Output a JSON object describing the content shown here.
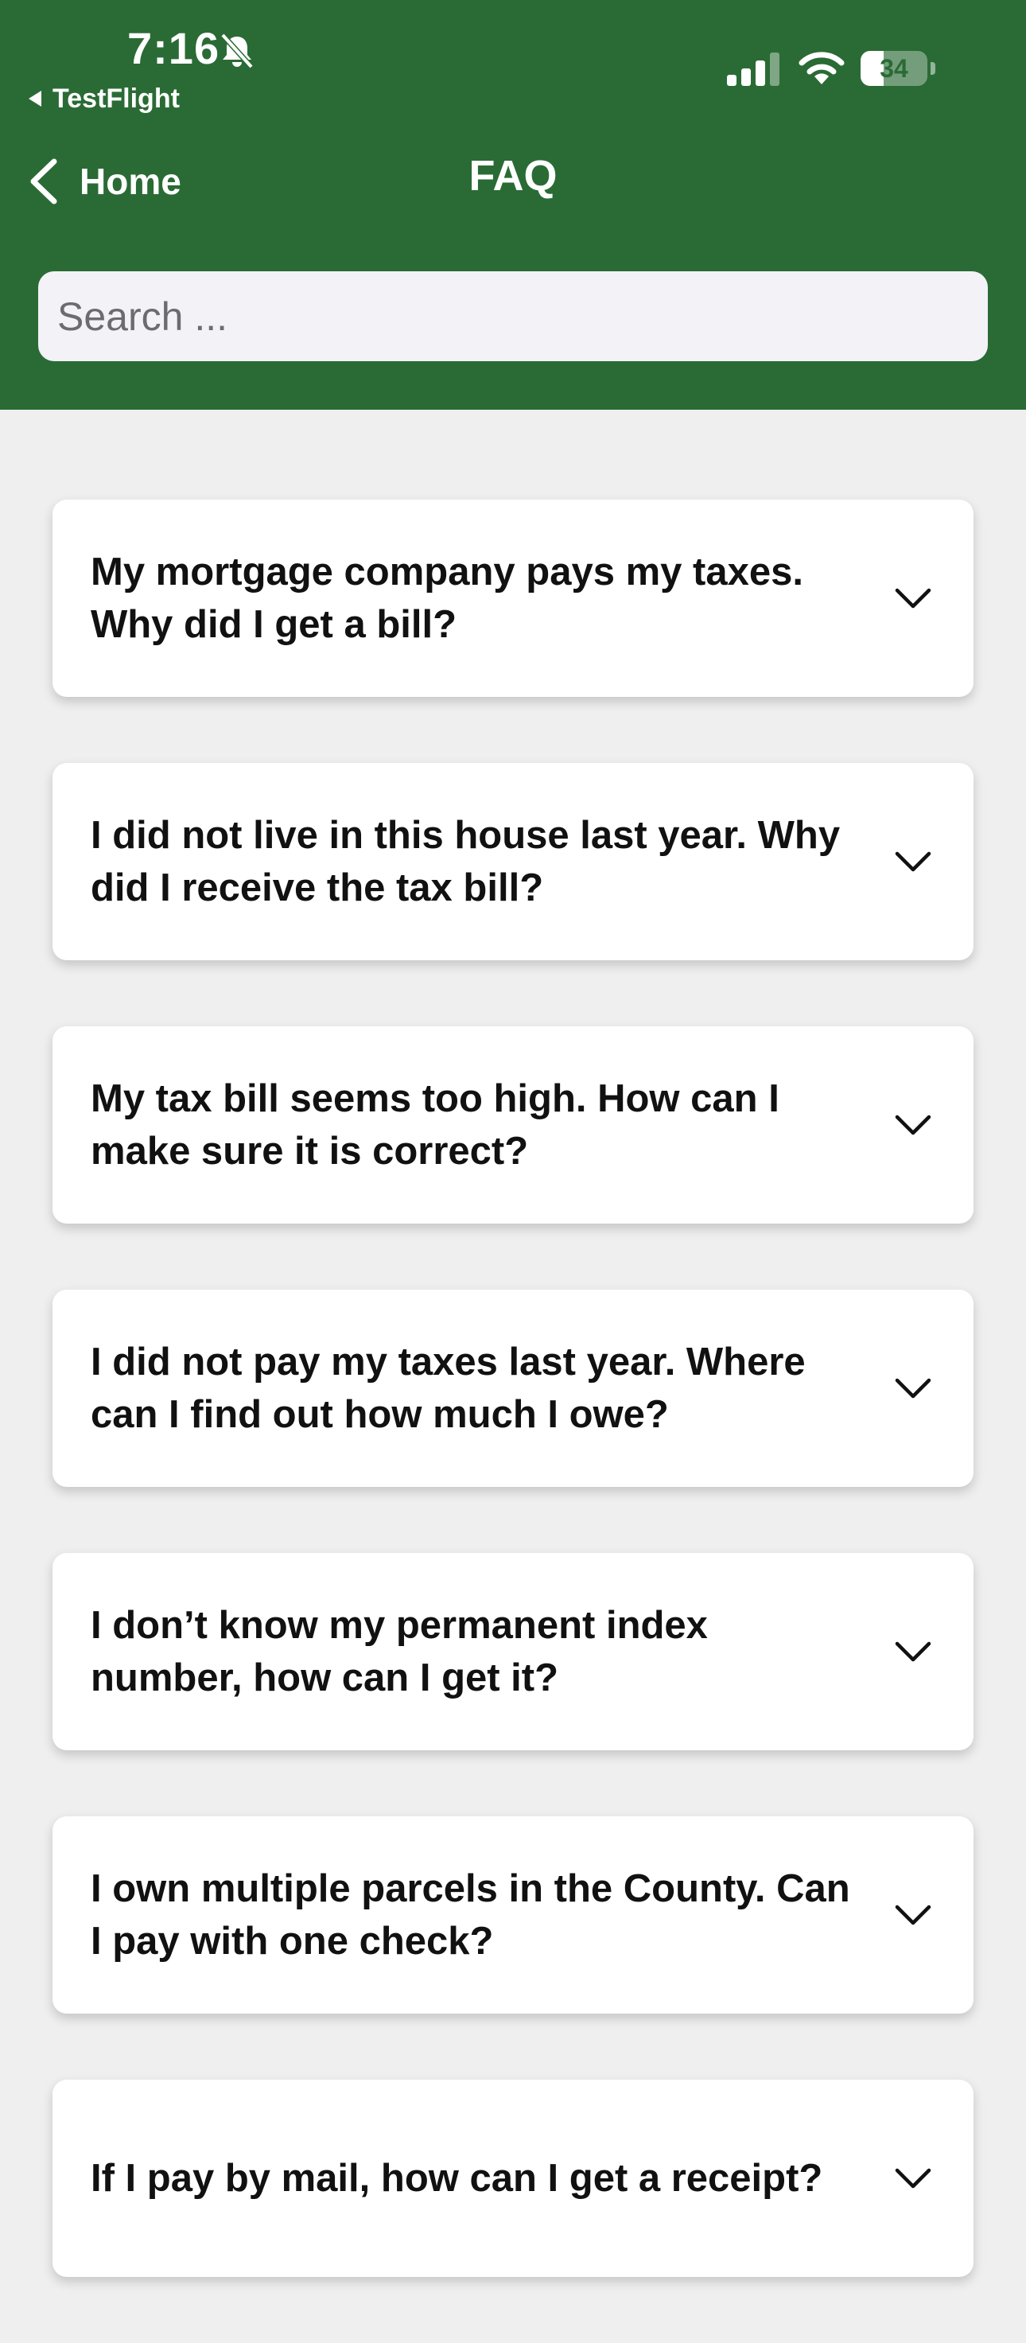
{
  "status_bar": {
    "time": "7:16",
    "back_app_label": "TestFlight",
    "battery_level": "34",
    "icons": [
      "bell-slash-icon",
      "signal-icon",
      "wifi-icon",
      "battery-icon"
    ]
  },
  "nav": {
    "back_label": "Home",
    "title": "FAQ"
  },
  "search": {
    "placeholder": "Search ..."
  },
  "faq": {
    "items": [
      {
        "question": "My mortgage company pays my taxes. Why did I get a bill?"
      },
      {
        "question": "I did not live in this house last year. Why did I receive the tax bill?"
      },
      {
        "question": "My tax bill seems too high. How can I make sure it is correct?"
      },
      {
        "question": "I did not pay my taxes last year. Where can I find out how much I owe?"
      },
      {
        "question": "I don’t know my permanent index number, how can I get it?"
      },
      {
        "question": "I own multiple parcels in the County. Can I pay with one check?"
      },
      {
        "question": "If I pay by mail, how can I get a receipt?"
      }
    ]
  },
  "colors": {
    "header_green": "#2a6b35",
    "background": "#efefef",
    "card": "#ffffff",
    "search_field": "#f2f2f7"
  }
}
